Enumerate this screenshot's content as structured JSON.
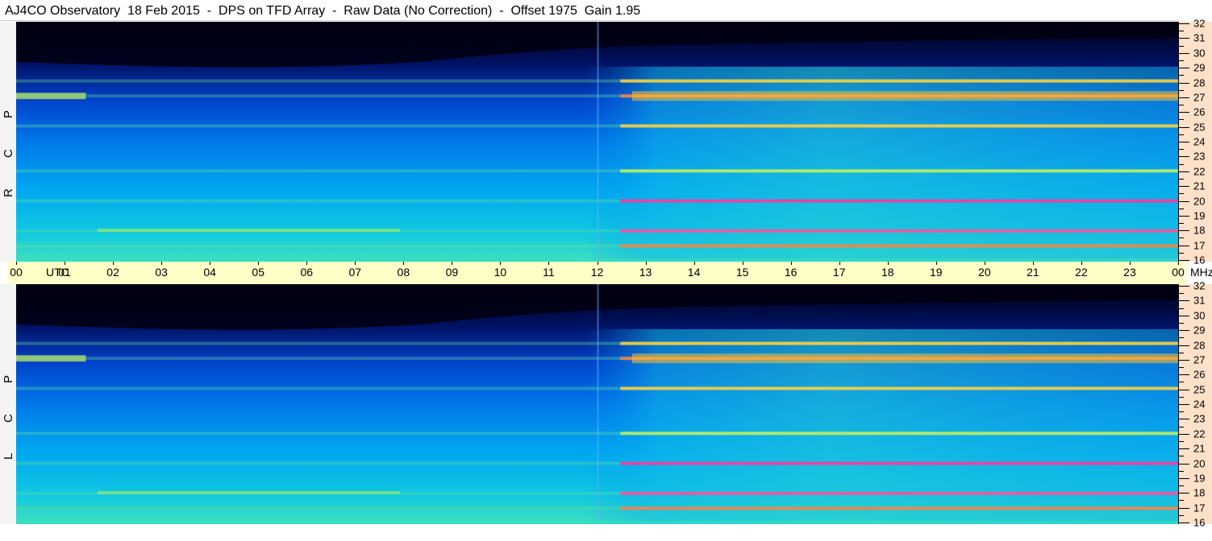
{
  "header": {
    "title": "AJ4CO Observatory  18 Feb 2015  -  DPS on TFD Array  -  Raw Data (No Correction)  -  Offset 1975  Gain 1.95"
  },
  "panels": {
    "rcp_label": "R C P",
    "lcp_label": "L C P"
  },
  "time_axis": {
    "labels": [
      "00",
      "01",
      "02",
      "03",
      "04",
      "05",
      "06",
      "07",
      "08",
      "09",
      "10",
      "11",
      "12",
      "13",
      "14",
      "15",
      "16",
      "17",
      "18",
      "19",
      "20",
      "21",
      "22",
      "23",
      "00"
    ],
    "unit_label": "UTC",
    "freq_unit_label": "MHz"
  },
  "freq_axis": {
    "labels": [
      "32",
      "31",
      "30",
      "29",
      "28",
      "27",
      "26",
      "25",
      "24",
      "23",
      "22",
      "21",
      "20",
      "19",
      "18",
      "17",
      "16"
    ]
  },
  "colors": {
    "background": "#ffffff",
    "time_bar": "#ffffc8",
    "freq_scale": "#ffe0c8",
    "colormap": [
      "#000010",
      "#001a7a",
      "#0050e0",
      "#00a8f0",
      "#30e0c0",
      "#c0f060",
      "#ff8040",
      "#ff30a0"
    ]
  },
  "chart_data": [
    {
      "type": "heatmap",
      "polarization": "R C P",
      "x_unit": "UTC",
      "x_range": [
        "00",
        "00"
      ],
      "y_unit": "MHz",
      "ylim": [
        16,
        32
      ],
      "noise_floor_rise_utc": "12-13",
      "strong_bands_mhz": [
        17,
        18,
        20,
        22,
        25,
        27,
        28
      ],
      "hot_spot_band_mhz": 27,
      "interference_line_utc": "12"
    },
    {
      "type": "heatmap",
      "polarization": "L C P",
      "x_unit": "UTC",
      "x_range": [
        "00",
        "00"
      ],
      "y_unit": "MHz",
      "ylim": [
        16,
        32
      ],
      "noise_floor_rise_utc": "12-13",
      "strong_bands_mhz": [
        17,
        18,
        20,
        22,
        25,
        27,
        28
      ],
      "hot_spot_band_mhz": 27,
      "interference_line_utc": "12"
    }
  ]
}
